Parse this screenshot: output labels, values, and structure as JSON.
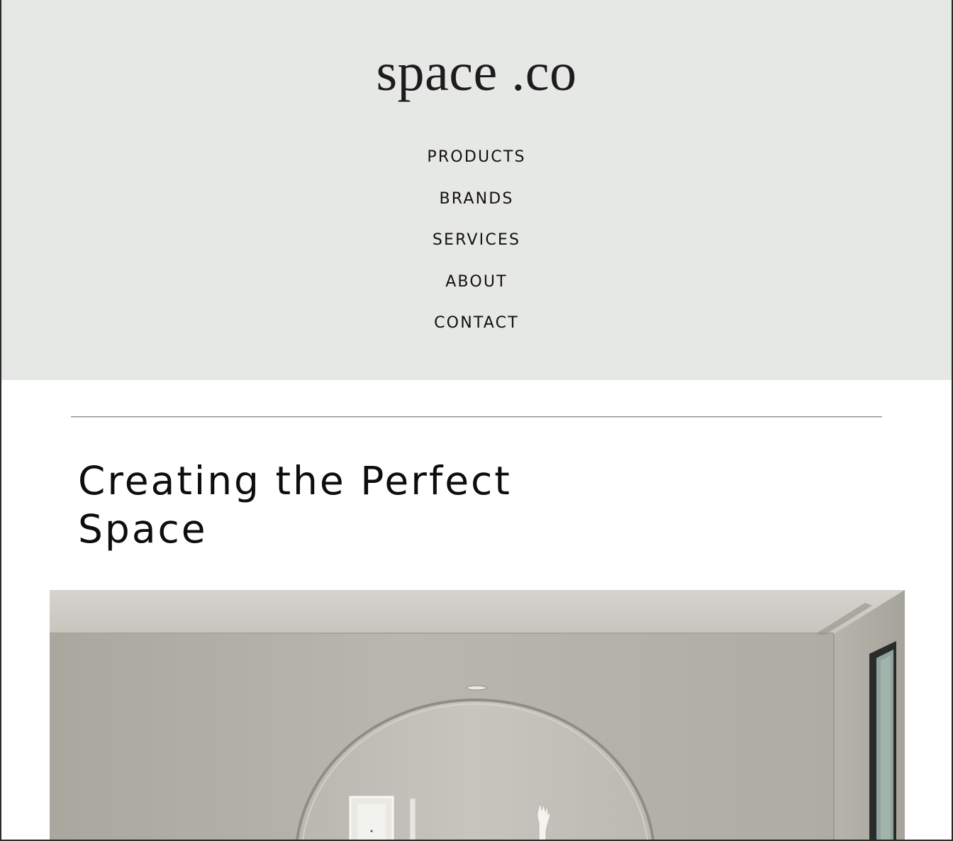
{
  "brand": {
    "logo_text": "space .co"
  },
  "nav": {
    "items": [
      {
        "label": "PRODUCTS"
      },
      {
        "label": "BRANDS"
      },
      {
        "label": "SERVICES"
      },
      {
        "label": "ABOUT"
      },
      {
        "label": "CONTACT"
      }
    ]
  },
  "main": {
    "headline": "Creating the Perfect Space"
  },
  "colors": {
    "header_bg": "#e6e8e5",
    "text": "#111111",
    "page_bg": "#ffffff"
  }
}
